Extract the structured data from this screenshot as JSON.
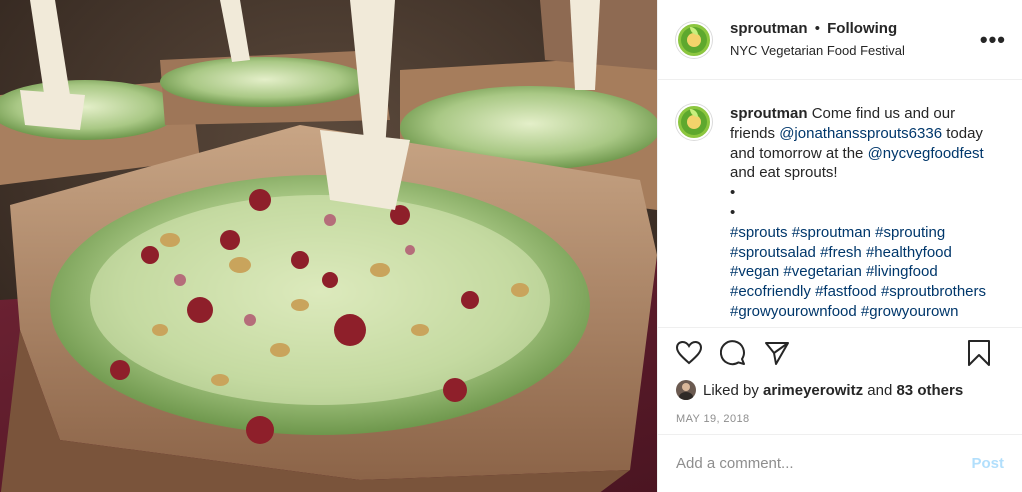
{
  "header": {
    "username": "sproutman",
    "separator": "•",
    "follow_status": "Following",
    "location": "NYC Vegetarian Food Festival",
    "more_icon": "more-horizontal-icon",
    "more_glyph": "•••"
  },
  "caption": {
    "username": "sproutman",
    "text_1": "Come find us and our friends",
    "mention_1": "@jonathanssprouts6336",
    "text_2": "today and tomorrow at the",
    "mention_2": "@nycvegfoodfest",
    "text_3": "and eat sprouts!",
    "bullet_1": "•",
    "bullet_2": "•",
    "hashtags": [
      "#sprouts",
      "#sproutman",
      "#sprouting",
      "#sproutsalad",
      "#fresh",
      "#healthyfood",
      "#vegan",
      "#vegetarian",
      "#livingfood",
      "#ecofriendly",
      "#fastfood",
      "#sproutbrothers",
      "#growyourownfood",
      "#growyourown"
    ]
  },
  "actions": {
    "like_icon": "heart-icon",
    "comment_icon": "comment-icon",
    "share_icon": "share-icon",
    "save_icon": "bookmark-icon"
  },
  "likes": {
    "prefix": "Liked by",
    "user": "arimeyerowitz",
    "conjunction": "and",
    "others": "83 others"
  },
  "date": "MAY 19, 2018",
  "comment": {
    "placeholder": "Add a comment...",
    "post_label": "Post"
  },
  "colors": {
    "link": "#00376b",
    "post_disabled": "#b2dffc",
    "muted": "#8e8e8e",
    "text": "#262626"
  }
}
